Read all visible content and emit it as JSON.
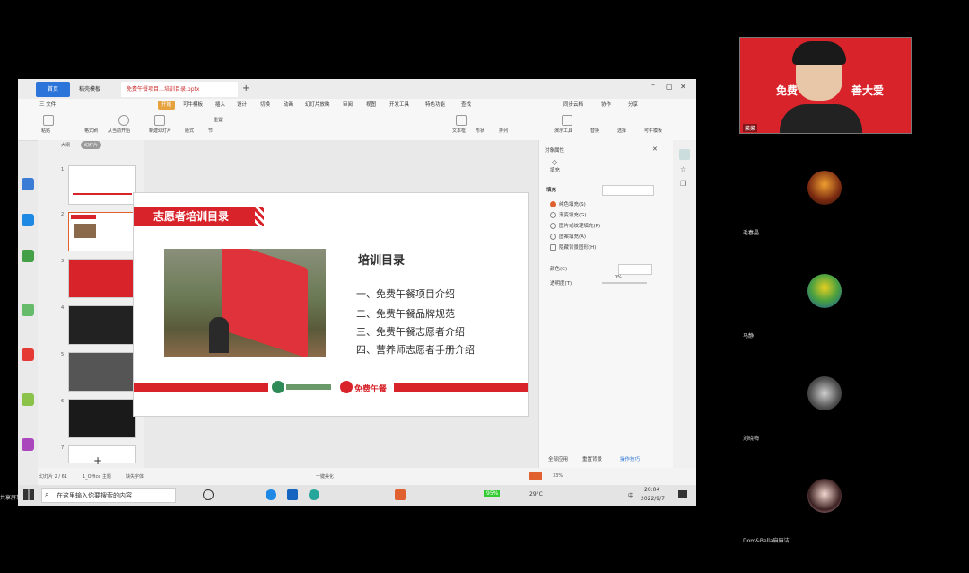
{
  "meeting": {
    "share_label": "共享屏幕",
    "participants": [
      {
        "name": "菜菜"
      },
      {
        "name": "毛春晶"
      },
      {
        "name": "马静"
      },
      {
        "name": "刘晓梅"
      },
      {
        "name": "Dom&Bella麻麻洁"
      }
    ],
    "speaker_banner_left": "免费",
    "speaker_banner_right": "善大爱"
  },
  "wps": {
    "tabs": [
      "首页",
      "稻壳模板",
      "免费午餐项目…培训目录.pptx"
    ],
    "menu": [
      "三 文件",
      "开始",
      "可牛模板",
      "插入",
      "设计",
      "切换",
      "动画",
      "幻灯片放映",
      "审阅",
      "视图",
      "开发工具",
      "特色功能",
      "查找"
    ],
    "menu_right": [
      "同步云档",
      "协作",
      "分享"
    ],
    "ribbon": [
      "粘贴",
      "格式刷",
      "从当前开始",
      "新建幻灯片",
      "版式",
      "重置",
      "节",
      "文本框",
      "形状",
      "排列",
      "演示工具",
      "替换",
      "选择",
      "可牛模板"
    ],
    "thumb_pane_tabs": [
      "大纲",
      "幻灯片"
    ],
    "thumb_numbers": [
      "1",
      "2",
      "3",
      "4",
      "5",
      "6",
      "7"
    ],
    "slide": {
      "banner_title": "志愿者培训目录",
      "heading": "培训目录",
      "items": [
        "一、免费午餐项目介绍",
        "二、免费午餐品牌规范",
        "三、免费午餐志愿者介绍",
        "四、营养师志愿者手册介绍"
      ],
      "footer_logo_text": "免费午餐"
    },
    "props": {
      "header": "对象属性",
      "tab": "填充",
      "section": "填充",
      "options": [
        "纯色填充(S)",
        "渐变填充(G)",
        "图片或纹理填充(P)",
        "图案填充(A)",
        "隐藏背景图形(H)"
      ],
      "color_label": "颜色(C)",
      "transparency_label": "透明度(T)",
      "transparency_value": "0%",
      "bottom_buttons": [
        "全部应用",
        "重置背景",
        "操作技巧"
      ]
    },
    "status": {
      "slide_info": "幻灯片 2 / 61",
      "theme": "1_Office 主题",
      "missing_font": "缺失字体",
      "beautify": "一键美化",
      "zoom": "33%"
    }
  },
  "taskbar": {
    "search_placeholder": "在这里输入你要搜索的内容",
    "battery": "95%",
    "weather": "29°C",
    "ime": "中",
    "time": "20:04",
    "date": "2022/9/7"
  },
  "colors": {
    "brand_red": "#d8232a",
    "wps_blue": "#2b74d9"
  }
}
